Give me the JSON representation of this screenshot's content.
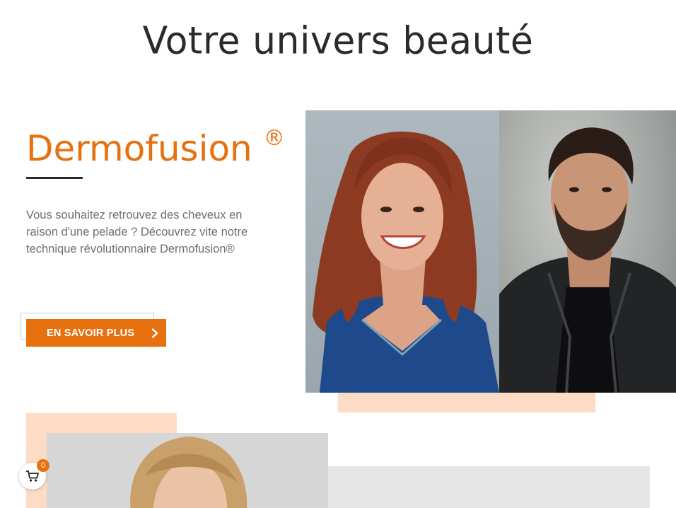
{
  "page": {
    "title": "Votre univers beauté"
  },
  "feature": {
    "heading": "Dermofusion",
    "heading_mark": "®",
    "description": "Vous souhaitez retrouvez des cheveux en raison d'une pelade ? Découvrez vite notre technique révolutionnaire Dermofusion®",
    "cta_label": "EN SAVOIR PLUS",
    "cta_icon": "chevron-right-icon"
  },
  "cart": {
    "icon": "cart-icon",
    "count": "0"
  },
  "colors": {
    "accent": "#e8710f",
    "peach": "#fcdcc4",
    "text_dark": "#2b2b2b",
    "text_muted": "#6e6e6e"
  }
}
